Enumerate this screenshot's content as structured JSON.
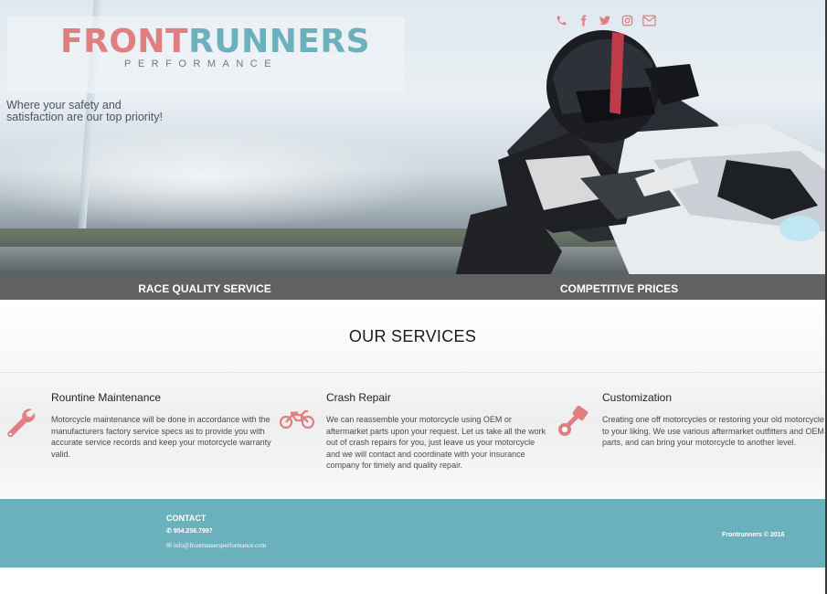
{
  "brand": {
    "name_part1": "FRONT",
    "name_part2": "RUNNERS",
    "subtitle": "PERFORMANCE",
    "tagline_line1": "Where your safety and",
    "tagline_line2": "satisfaction are our top priority!",
    "colors": {
      "pink": "#e07f82",
      "teal": "#6cb0bd",
      "strip": "#616161"
    }
  },
  "social": [
    {
      "icon": "phone-icon"
    },
    {
      "icon": "facebook-icon"
    },
    {
      "icon": "twitter-icon"
    },
    {
      "icon": "instagram-icon"
    },
    {
      "icon": "email-icon"
    }
  ],
  "highlights": {
    "left": "RACE QUALITY SERVICE",
    "right": "COMPETITIVE PRICES"
  },
  "services": {
    "heading": "OUR SERVICES",
    "items": [
      {
        "icon": "wrench-icon",
        "title": "Rountine Maintenance",
        "description": "Motorcycle maintenance will be done in accordance with the manufacturers factory service specs as to provide you with accurate service records and keep your motorcycle warranty valid."
      },
      {
        "icon": "motorcycle-icon",
        "title": "Crash Repair",
        "description": "We can reassemble your motorcycle using OEM or aftermarket parts upon your request. Let us take all the work out of crash repairs for you, just leave us your motorcycle and we will contact and coordinate with your insurance company for timely and quality repair."
      },
      {
        "icon": "piston-icon",
        "title": "Customization",
        "description": "Creating one off motorcycles or restoring your old motorcycle to your liking. We use various aftermarket outfitters and OEM parts, and can bring your motorcycle to another level."
      }
    ]
  },
  "footer": {
    "contact_label": "CONTACT",
    "phone": "954.256.7997",
    "email": "info@frontrunnersperformance.com",
    "copyright": "Frontrunners © 2016"
  }
}
